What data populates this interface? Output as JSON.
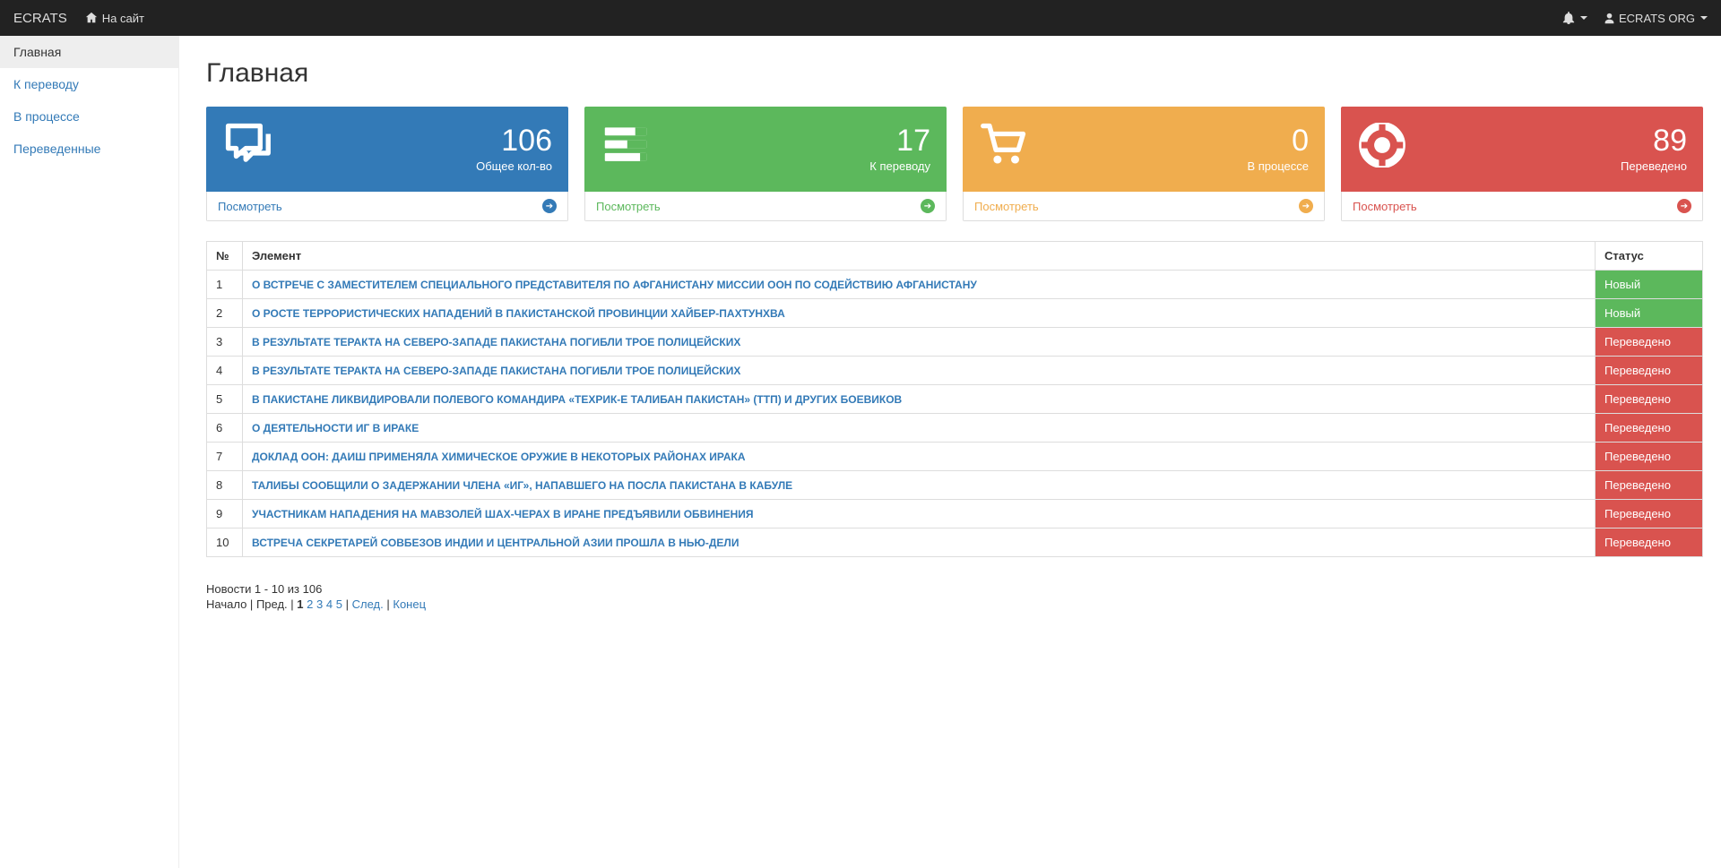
{
  "navbar": {
    "brand": "ECRATS",
    "to_site": "На сайт",
    "user": "ECRATS ORG"
  },
  "sidebar": {
    "items": [
      {
        "label": "Главная",
        "active": true
      },
      {
        "label": "К переводу",
        "active": false
      },
      {
        "label": "В процессе",
        "active": false
      },
      {
        "label": "Переведенные",
        "active": false
      }
    ]
  },
  "page": {
    "title": "Главная"
  },
  "cards": [
    {
      "value": "106",
      "label": "Общее кол-во",
      "footer": "Посмотреть",
      "color": "blue",
      "icon": "comments"
    },
    {
      "value": "17",
      "label": "К переводу",
      "footer": "Посмотреть",
      "color": "green",
      "icon": "tasks"
    },
    {
      "value": "0",
      "label": "В процессе",
      "footer": "Посмотреть",
      "color": "orange",
      "icon": "cart"
    },
    {
      "value": "89",
      "label": "Переведено",
      "footer": "Посмотреть",
      "color": "red",
      "icon": "support"
    }
  ],
  "table": {
    "headers": {
      "num": "№",
      "item": "Элемент",
      "status": "Статус"
    },
    "rows": [
      {
        "num": "1",
        "item": "О ВСТРЕЧЕ С ЗАМЕСТИТЕЛЕМ СПЕЦИАЛЬНОГО ПРЕДСТАВИТЕЛЯ ПО АФГАНИСТАНУ МИССИИ ООН ПО СОДЕЙСТВИЮ АФГАНИСТАНУ",
        "status": "Новый",
        "status_kind": "new"
      },
      {
        "num": "2",
        "item": "О РОСТЕ ТЕРРОРИСТИЧЕСКИХ НАПАДЕНИЙ В ПАКИСТАНСКОЙ ПРОВИНЦИИ ХАЙБЕР-ПАХТУНХВА",
        "status": "Новый",
        "status_kind": "new"
      },
      {
        "num": "3",
        "item": "В РЕЗУЛЬТАТЕ ТЕРАКТА НА СЕВЕРО-ЗАПАДЕ ПАКИСТАНА ПОГИБЛИ ТРОЕ ПОЛИЦЕЙСКИХ",
        "status": "Переведено",
        "status_kind": "translated"
      },
      {
        "num": "4",
        "item": "В РЕЗУЛЬТАТЕ ТЕРАКТА НА СЕВЕРО-ЗАПАДЕ ПАКИСТАНА ПОГИБЛИ ТРОЕ ПОЛИЦЕЙСКИХ",
        "status": "Переведено",
        "status_kind": "translated"
      },
      {
        "num": "5",
        "item": "В ПАКИСТАНЕ ЛИКВИДИРОВАЛИ ПОЛЕВОГО КОМАНДИРА «ТЕХРИК-Е ТАЛИБАН ПАКИСТАН» (ТТП) И ДРУГИХ БОЕВИКОВ",
        "status": "Переведено",
        "status_kind": "translated"
      },
      {
        "num": "6",
        "item": "О ДЕЯТЕЛЬНОСТИ ИГ В ИРАКЕ",
        "status": "Переведено",
        "status_kind": "translated"
      },
      {
        "num": "7",
        "item": "ДОКЛАД ООН: ДАИШ ПРИМЕНЯЛА ХИМИЧЕСКОЕ ОРУЖИЕ В НЕКОТОРЫХ РАЙОНАХ ИРАКА",
        "status": "Переведено",
        "status_kind": "translated"
      },
      {
        "num": "8",
        "item": "ТАЛИБЫ СООБЩИЛИ О ЗАДЕРЖАНИИ ЧЛЕНА «ИГ», НАПАВШЕГО НА ПОСЛА ПАКИСТАНА В КАБУЛЕ",
        "status": "Переведено",
        "status_kind": "translated"
      },
      {
        "num": "9",
        "item": "УЧАСТНИКАМ НАПАДЕНИЯ НА МАВЗОЛЕЙ ШАХ-ЧЕРАХ В ИРАНЕ ПРЕДЪЯВИЛИ ОБВИНЕНИЯ",
        "status": "Переведено",
        "status_kind": "translated"
      },
      {
        "num": "10",
        "item": "ВСТРЕЧА СЕКРЕТАРЕЙ СОВБЕЗОВ ИНДИИ И ЦЕНТРАЛЬНОЙ АЗИИ ПРОШЛА В НЬЮ-ДЕЛИ",
        "status": "Переведено",
        "status_kind": "translated"
      }
    ]
  },
  "pager": {
    "info": "Новости 1 - 10 из 106",
    "begin": "Начало",
    "prev": "Пред.",
    "pages": [
      "1",
      "2",
      "3",
      "4",
      "5"
    ],
    "current": "1",
    "next": "След.",
    "end": "Конец"
  }
}
